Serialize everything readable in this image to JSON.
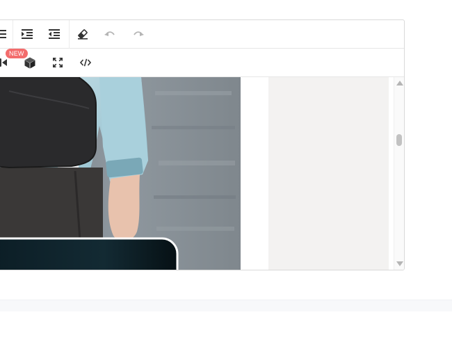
{
  "toolbar": {
    "new_badge": "NEW"
  },
  "icons": {
    "row1": [
      "list-icon",
      "indent-increase-icon",
      "indent-decrease-icon",
      "eraser-icon",
      "undo-icon",
      "redo-icon"
    ],
    "row2": [
      "video-icon",
      "cube-icon",
      "fullscreen-icon",
      "code-view-icon"
    ]
  },
  "colors": {
    "badge": "#f36c6c",
    "icon": "#333333",
    "icon_disabled": "#b5b5b5",
    "side_panel": "#f3f2f1",
    "border": "#d9d9d9"
  }
}
